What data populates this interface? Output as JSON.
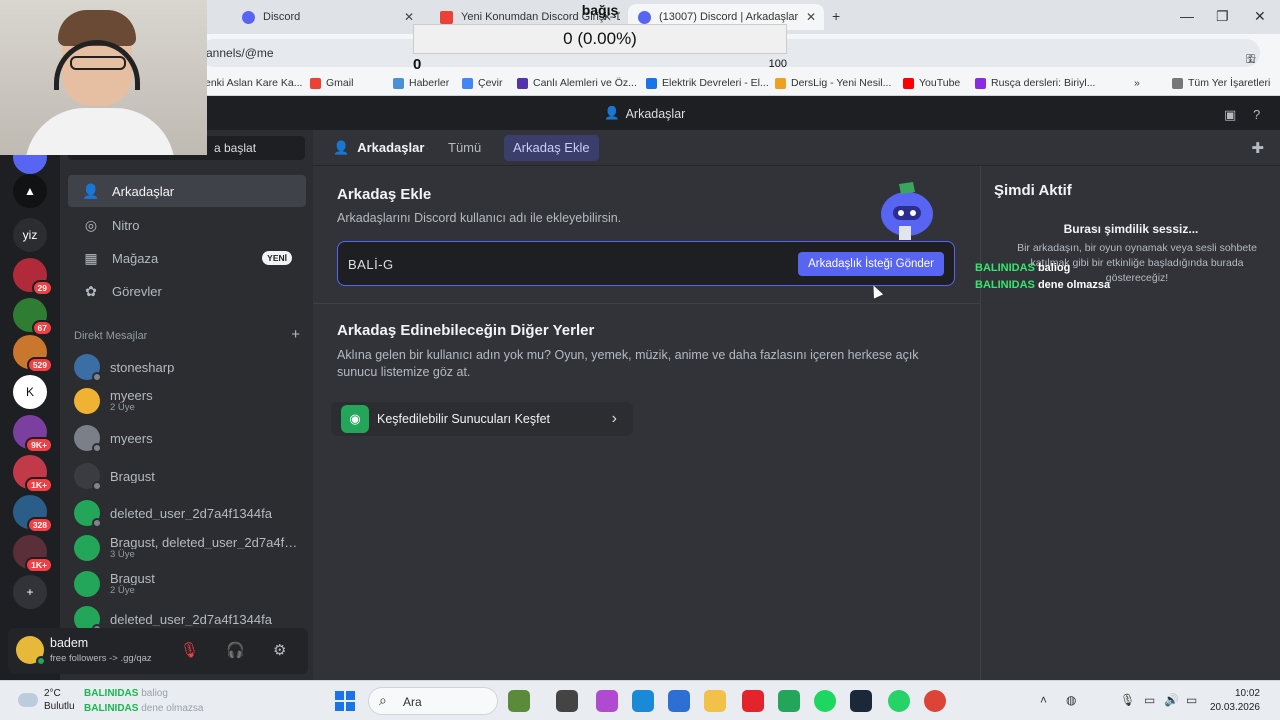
{
  "browser": {
    "tabs": [
      {
        "label": "Discord",
        "active": false
      },
      {
        "label": "Yeni Konumdan Discord Girişi - D...",
        "active": false
      },
      {
        "label": "(13007) Discord | Arkadaşlar",
        "active": true
      }
    ],
    "address": "annels/@me",
    "bookmarks": [
      "enki Aslan Kare Ka...",
      "Gmail",
      "Haberler",
      "Çevir",
      "Canlı Alemleri ve Öz...",
      "Elektrik Devreleri - El...",
      "DersLig - Yeni Nesil...",
      "YouTube",
      "Rusça dersleri: Biriyl...",
      "Tüm Yer İşaretleri"
    ]
  },
  "overlay": {
    "title": "bağış",
    "counter": "0 (0.00%)",
    "min": "0",
    "max": "100",
    "progress": 0
  },
  "discord": {
    "window_title": "Arkadaşlar",
    "servers": [
      {
        "label": "",
        "badge": "",
        "color": "#5865f2"
      },
      {
        "label": "▲",
        "badge": "",
        "color": "#111214"
      },
      {
        "label": "yiz",
        "badge": "",
        "color": "#2b2d31"
      },
      {
        "label": "",
        "badge": "29",
        "color": "#b02a3a"
      },
      {
        "label": "",
        "badge": "67",
        "color": "#2f7d32"
      },
      {
        "label": "",
        "badge": "529",
        "color": "#c9772c"
      },
      {
        "label": "K",
        "badge": "",
        "color": "#ffffff"
      },
      {
        "label": "",
        "badge": "9K+",
        "color": "#7b3fa0"
      },
      {
        "label": "",
        "badge": "1K+",
        "color": "#c23a4a"
      },
      {
        "label": "",
        "badge": "328",
        "color": "#2a5e88"
      },
      {
        "label": "",
        "badge": "1K+",
        "color": "#5a2f3a"
      },
      {
        "label": "+",
        "badge": "",
        "color": "#313338"
      }
    ],
    "search_label": "a başlat",
    "nav": [
      {
        "label": "Arkadaşlar",
        "icon": "friends-icon",
        "selected": true
      },
      {
        "label": "Nitro",
        "icon": "nitro-icon",
        "selected": false
      },
      {
        "label": "Mağaza",
        "icon": "shop-icon",
        "selected": false,
        "badge": "YENİ"
      },
      {
        "label": "Görevler",
        "icon": "quests-icon",
        "selected": false
      }
    ],
    "dm_header": "Direkt Mesajlar",
    "dms": [
      {
        "name": "stonesharp",
        "sub": "",
        "color": "#3b6ea5"
      },
      {
        "name": "myeers",
        "sub": "2 Üye",
        "color": "#f0b232"
      },
      {
        "name": "myeers",
        "sub": "",
        "color": "#7a7f88"
      },
      {
        "name": "Bragust",
        "sub": "",
        "color": "#3a3c42"
      },
      {
        "name": "deleted_user_2d7a4f1344fa",
        "sub": "",
        "color": "#23a55a"
      },
      {
        "name": "Bragust, deleted_user_2d7a4f1...",
        "sub": "3 Üye",
        "color": "#23a55a"
      },
      {
        "name": "Bragust",
        "sub": "2 Üye",
        "color": "#23a55a"
      },
      {
        "name": "deleted_user_2d7a4f1344fa",
        "sub": "",
        "color": "#23a55a"
      }
    ],
    "user": {
      "name": "badem",
      "status": "free followers -> .gg/qaz"
    },
    "header": {
      "title": "Arkadaşlar",
      "tabs": [
        "Tümü",
        "Arkadaş Ekle"
      ]
    },
    "add_friend": {
      "title": "Arkadaş Ekle",
      "desc": "Arkadaşlarını Discord kullanıcı adı ile ekleyebilirsin.",
      "input_value": "BALİ-G",
      "button": "Arkadaşlık İsteği Gönder"
    },
    "other_places": {
      "title": "Arkadaş Edinebileceğin Diğer Yerler",
      "desc": "Aklına gelen bir kullanıcı adın yok mu? Oyun, yemek, müzik, anime ve daha fazlasını içeren herkese açık sunucu listemize göz at.",
      "explore": "Keşfedilebilir Sunucuları Keşfet"
    },
    "active_now": {
      "title": "Şimdi Aktif",
      "quiet": "Burası şimdilik sessiz...",
      "quiet_desc": "Bir arkadaşın, bir oyun oynamak veya sesli sohbete katılmak gibi bir etkinliğe başladığında burada göstereceğiz!"
    }
  },
  "stream_chat": [
    {
      "user": "BALINIDAS",
      "msg": "baliog"
    },
    {
      "user": "BALINIDAS",
      "msg": "dene olmazsa"
    }
  ],
  "taskbar": {
    "temp": "2°C",
    "weather": "Bulutlu",
    "search": "Ara",
    "time": "10:02",
    "date": "20.03.2026"
  }
}
